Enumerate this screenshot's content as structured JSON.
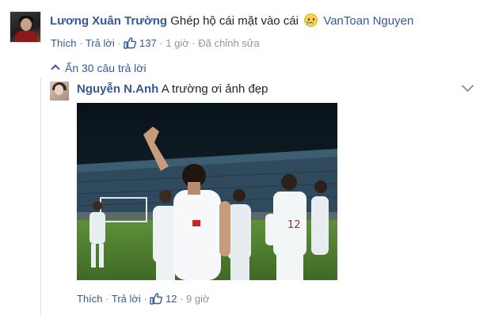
{
  "comment": {
    "author": "Lương Xuân Trường",
    "text": "Ghép hộ cái mặt vào cái",
    "emoji": "crying-face-icon",
    "mention": "VanToan Nguyen",
    "like_label": "Thích",
    "reply_label": "Trả lời",
    "like_count": "137",
    "time": "1 giờ",
    "edited": "Đã chỉnh sửa"
  },
  "hide_replies": "Ẩn 30 câu trả lời",
  "reply": {
    "author": "Nguyễn N.Anh",
    "text": "A trường ơi ảnh đẹp",
    "like_label": "Thích",
    "reply_label": "Trả lời",
    "like_count": "12",
    "time": "9 giờ"
  },
  "colors": {
    "link": "#365899",
    "meta": "#90949c",
    "text": "#1d2129"
  }
}
